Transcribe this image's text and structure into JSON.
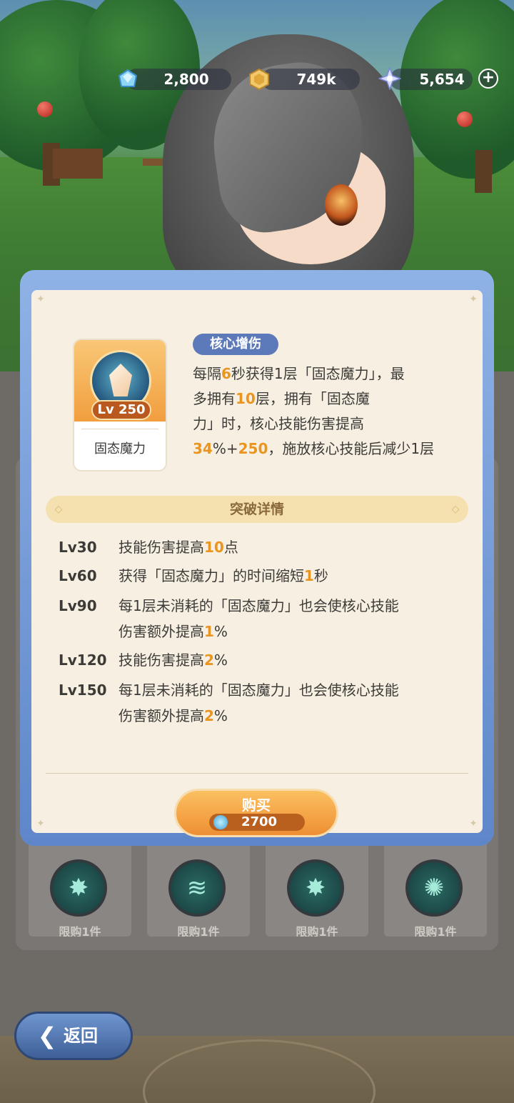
{
  "currency": {
    "diamond": "2,800",
    "gold": "749k",
    "star": "5,654",
    "add_label": "+"
  },
  "modal": {
    "skill": {
      "level": "Lv 250",
      "name": "固态魔力"
    },
    "tag": "核心增伤",
    "description": [
      [
        {
          "t": "每隔"
        },
        {
          "t": "6",
          "h": true
        },
        {
          "t": "秒获得1层「固态魔力」，最"
        }
      ],
      [
        {
          "t": "多拥有"
        },
        {
          "t": "10",
          "h": true
        },
        {
          "t": "层，拥有「固态魔"
        }
      ],
      [
        {
          "t": "力」时，核心技能伤害提高"
        }
      ],
      [
        {
          "t": "34",
          "h": true
        },
        {
          "t": "%+"
        },
        {
          "t": "250",
          "h": true
        },
        {
          "t": "，施放核心技能后减少1层"
        }
      ]
    ],
    "section_title": "突破详情",
    "breakthroughs": [
      {
        "lv": "Lv30",
        "lines": [
          [
            {
              "t": "技能伤害提高"
            },
            {
              "t": "10",
              "h": true
            },
            {
              "t": "点"
            }
          ]
        ]
      },
      {
        "lv": "Lv60",
        "lines": [
          [
            {
              "t": "获得「固态魔力」的时间缩短"
            },
            {
              "t": "1",
              "h": true
            },
            {
              "t": "秒"
            }
          ]
        ]
      },
      {
        "lv": "Lv90",
        "lines": [
          [
            {
              "t": "每1层未消耗的「固态魔力」也会使核心技能"
            }
          ],
          [
            {
              "t": "伤害额外提高"
            },
            {
              "t": "1",
              "h": true
            },
            {
              "t": "%"
            }
          ]
        ]
      },
      {
        "lv": "Lv120",
        "lines": [
          [
            {
              "t": "技能伤害提高"
            },
            {
              "t": "2",
              "h": true
            },
            {
              "t": "%"
            }
          ]
        ]
      },
      {
        "lv": "Lv150",
        "lines": [
          [
            {
              "t": "每1层未消耗的「固态魔力」也会使核心技能"
            }
          ],
          [
            {
              "t": "伤害额外提高"
            },
            {
              "t": "2",
              "h": true
            },
            {
              "t": "%"
            }
          ]
        ]
      }
    ],
    "buy": {
      "label": "购买",
      "price": "2700"
    }
  },
  "shop_cards": [
    {
      "label": "限购1件",
      "icon": "burst-icon"
    },
    {
      "label": "限购1件",
      "icon": "wind-icon"
    },
    {
      "label": "限购1件",
      "icon": "burst-icon"
    },
    {
      "label": "限购1件",
      "icon": "explosion-icon"
    }
  ],
  "back_button": {
    "label": "返回"
  },
  "colors": {
    "highlight": "#e99520",
    "tag_bg": "#5c79b9",
    "modal_frame": "#6f93d3",
    "buy_button": "#f3a447"
  }
}
